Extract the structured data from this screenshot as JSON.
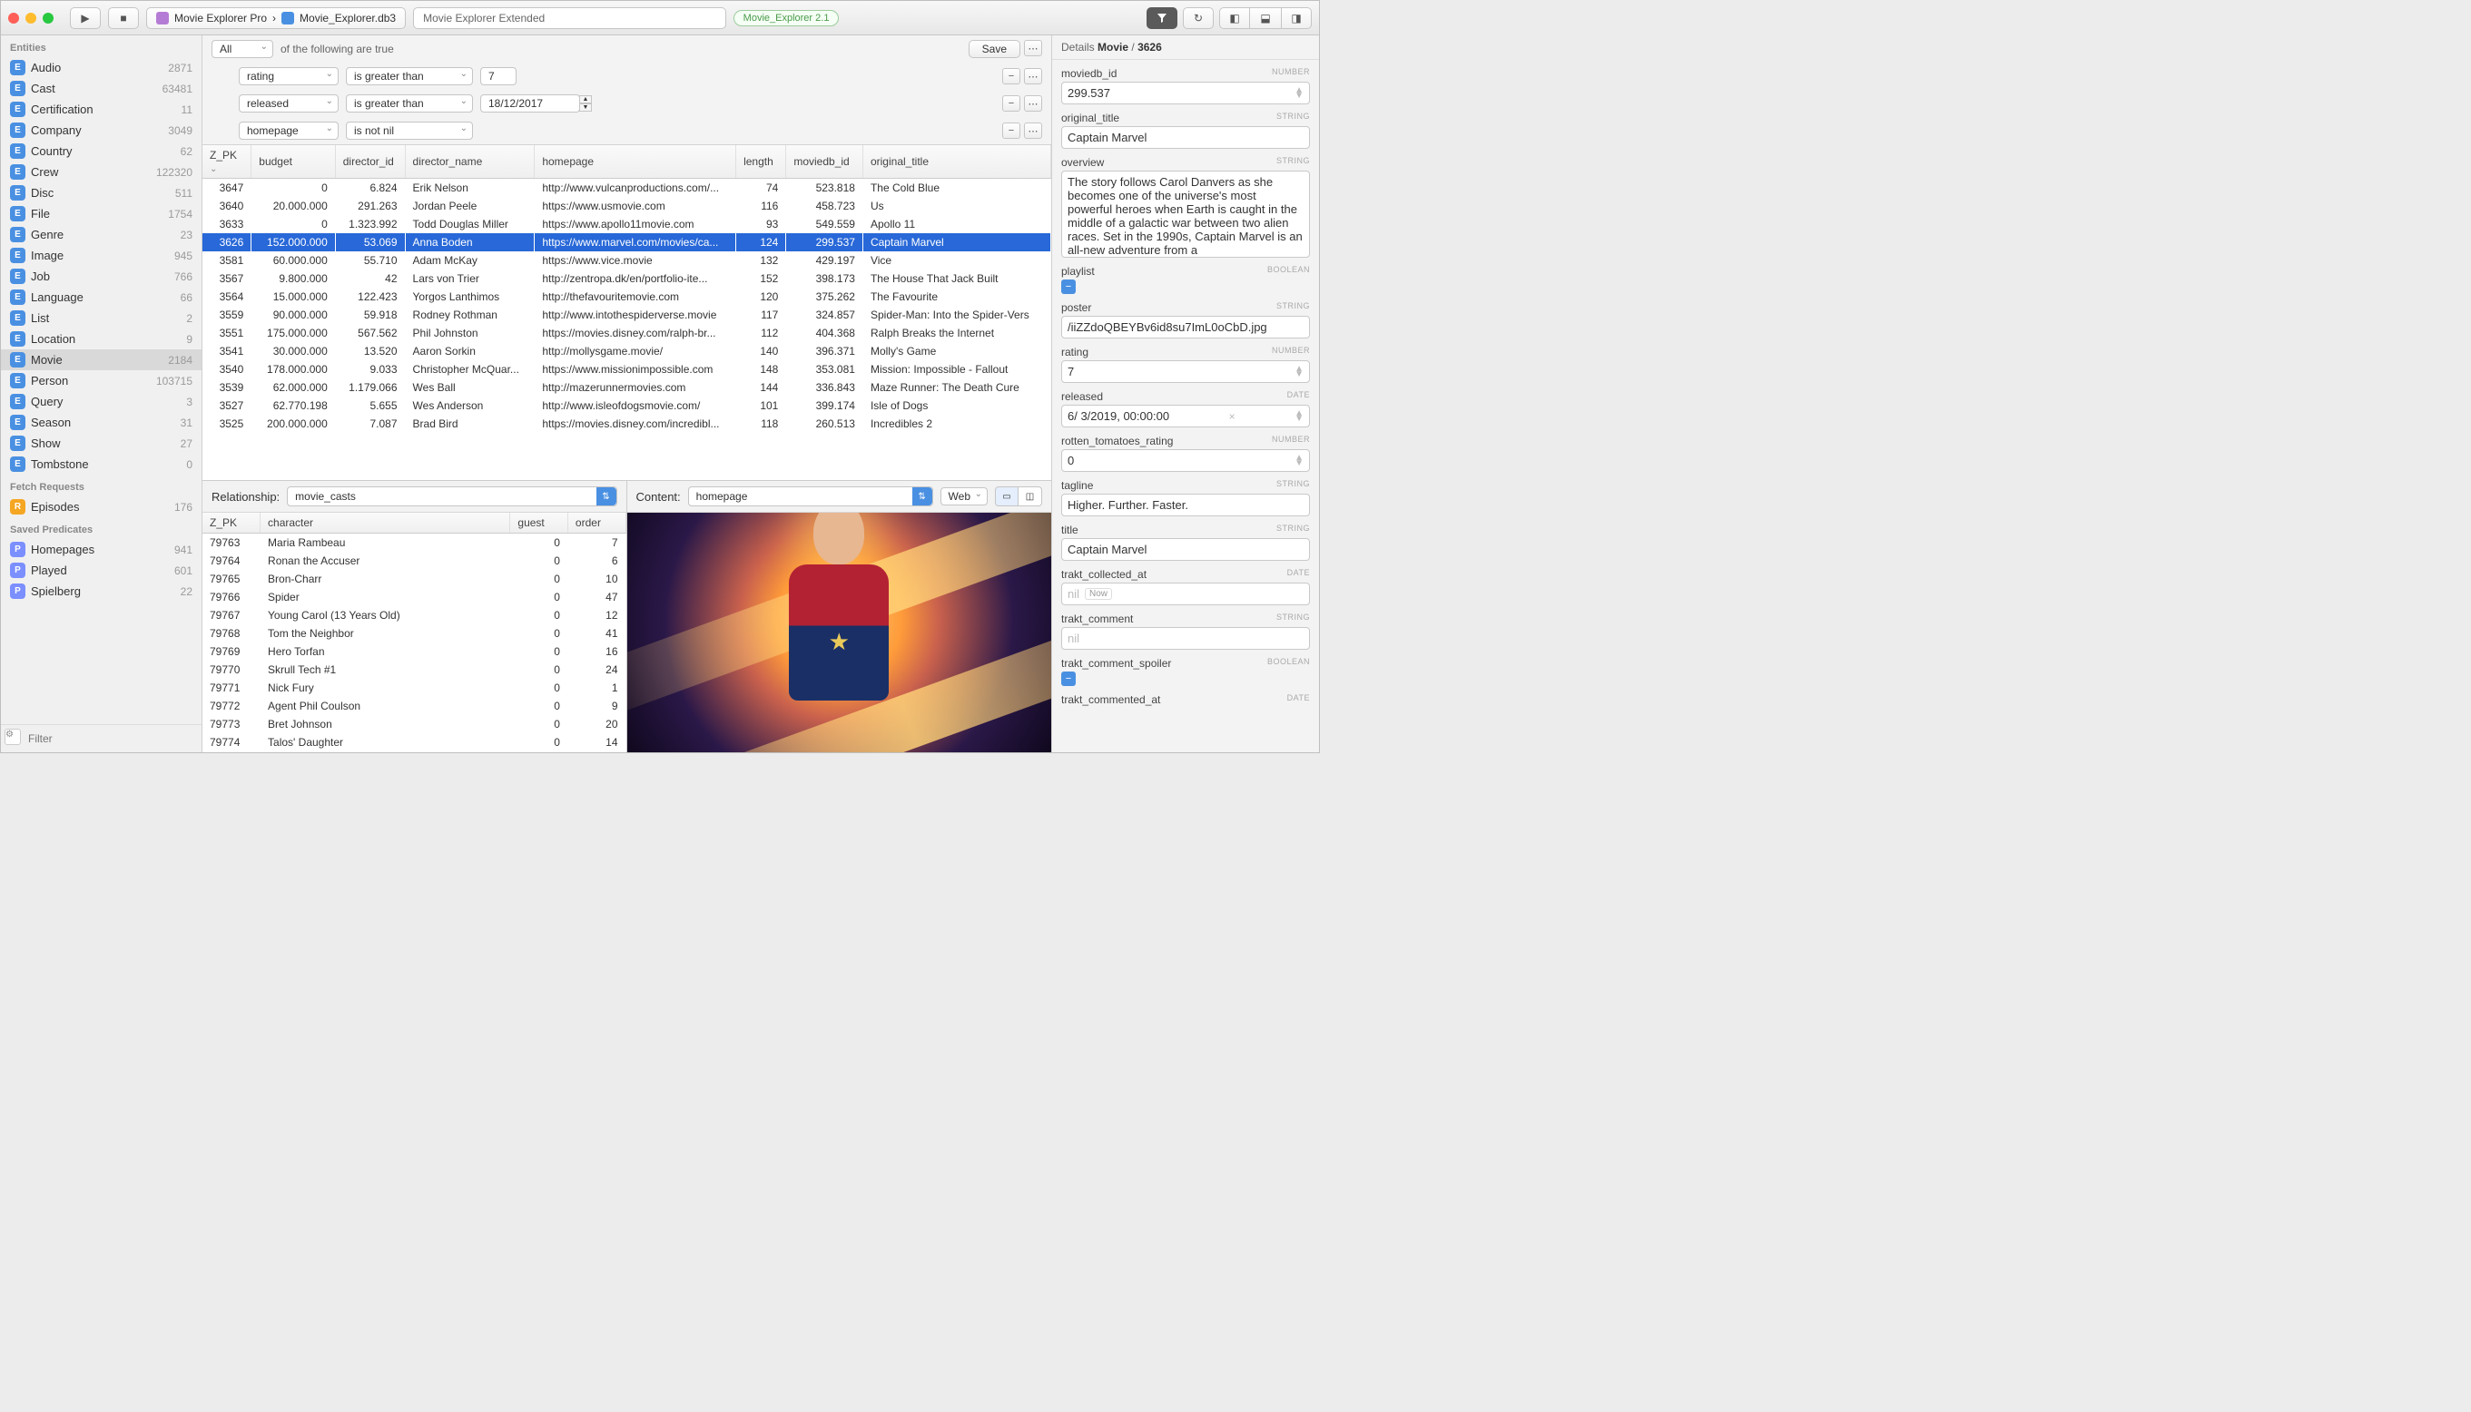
{
  "toolbar": {
    "breadcrumb": [
      "Movie Explorer Pro",
      "Movie_Explorer.db3"
    ],
    "title": "Movie Explorer Extended",
    "version": "Movie_Explorer 2.1"
  },
  "sidebar": {
    "sections": [
      {
        "title": "Entities",
        "kind": "E",
        "items": [
          {
            "label": "Audio",
            "count": "2871"
          },
          {
            "label": "Cast",
            "count": "63481"
          },
          {
            "label": "Certification",
            "count": "11"
          },
          {
            "label": "Company",
            "count": "3049"
          },
          {
            "label": "Country",
            "count": "62"
          },
          {
            "label": "Crew",
            "count": "122320"
          },
          {
            "label": "Disc",
            "count": "511"
          },
          {
            "label": "File",
            "count": "1754"
          },
          {
            "label": "Genre",
            "count": "23"
          },
          {
            "label": "Image",
            "count": "945"
          },
          {
            "label": "Job",
            "count": "766"
          },
          {
            "label": "Language",
            "count": "66"
          },
          {
            "label": "List",
            "count": "2"
          },
          {
            "label": "Location",
            "count": "9"
          },
          {
            "label": "Movie",
            "count": "2184",
            "selected": true
          },
          {
            "label": "Person",
            "count": "103715"
          },
          {
            "label": "Query",
            "count": "3"
          },
          {
            "label": "Season",
            "count": "31"
          },
          {
            "label": "Show",
            "count": "27"
          },
          {
            "label": "Tombstone",
            "count": "0"
          }
        ]
      },
      {
        "title": "Fetch Requests",
        "kind": "R",
        "items": [
          {
            "label": "Episodes",
            "count": "176"
          }
        ]
      },
      {
        "title": "Saved Predicates",
        "kind": "P",
        "items": [
          {
            "label": "Homepages",
            "count": "941"
          },
          {
            "label": "Played",
            "count": "601"
          },
          {
            "label": "Spielberg",
            "count": "22"
          }
        ]
      }
    ],
    "filter_placeholder": "Filter"
  },
  "predicates": {
    "scope": "All",
    "scope_suffix": "of the following are true",
    "save_label": "Save",
    "rows": [
      {
        "field": "rating",
        "op": "is greater than",
        "value": "7",
        "type": "number"
      },
      {
        "field": "released",
        "op": "is greater than",
        "value": "18/12/2017",
        "type": "date"
      },
      {
        "field": "homepage",
        "op": "is not nil",
        "value": null,
        "type": "nil"
      }
    ]
  },
  "main_table": {
    "columns": [
      "Z_PK",
      "budget",
      "director_id",
      "director_name",
      "homepage",
      "length",
      "moviedb_id",
      "original_title"
    ],
    "sort_col": "Z_PK",
    "rows": [
      {
        "pk": "3647",
        "budget": "0",
        "did": "6.824",
        "dname": "Erik Nelson",
        "hp": "http://www.vulcanproductions.com/...",
        "len": "74",
        "mid": "523.818",
        "title": "The Cold Blue"
      },
      {
        "pk": "3640",
        "budget": "20.000.000",
        "did": "291.263",
        "dname": "Jordan Peele",
        "hp": "https://www.usmovie.com",
        "len": "116",
        "mid": "458.723",
        "title": "Us"
      },
      {
        "pk": "3633",
        "budget": "0",
        "did": "1.323.992",
        "dname": "Todd Douglas Miller",
        "hp": "https://www.apollo11movie.com",
        "len": "93",
        "mid": "549.559",
        "title": "Apollo 11"
      },
      {
        "pk": "3626",
        "budget": "152.000.000",
        "did": "53.069",
        "dname": "Anna Boden",
        "hp": "https://www.marvel.com/movies/ca...",
        "len": "124",
        "mid": "299.537",
        "title": "Captain Marvel",
        "selected": true
      },
      {
        "pk": "3581",
        "budget": "60.000.000",
        "did": "55.710",
        "dname": "Adam McKay",
        "hp": "https://www.vice.movie",
        "len": "132",
        "mid": "429.197",
        "title": "Vice"
      },
      {
        "pk": "3567",
        "budget": "9.800.000",
        "did": "42",
        "dname": "Lars von Trier",
        "hp": "http://zentropa.dk/en/portfolio-ite...",
        "len": "152",
        "mid": "398.173",
        "title": "The House That Jack Built"
      },
      {
        "pk": "3564",
        "budget": "15.000.000",
        "did": "122.423",
        "dname": "Yorgos Lanthimos",
        "hp": "http://thefavouritemovie.com",
        "len": "120",
        "mid": "375.262",
        "title": "The Favourite"
      },
      {
        "pk": "3559",
        "budget": "90.000.000",
        "did": "59.918",
        "dname": "Rodney Rothman",
        "hp": "http://www.intothespiderverse.movie",
        "len": "117",
        "mid": "324.857",
        "title": "Spider-Man: Into the Spider-Vers"
      },
      {
        "pk": "3551",
        "budget": "175.000.000",
        "did": "567.562",
        "dname": "Phil Johnston",
        "hp": "https://movies.disney.com/ralph-br...",
        "len": "112",
        "mid": "404.368",
        "title": "Ralph Breaks the Internet"
      },
      {
        "pk": "3541",
        "budget": "30.000.000",
        "did": "13.520",
        "dname": "Aaron Sorkin",
        "hp": "http://mollysgame.movie/",
        "len": "140",
        "mid": "396.371",
        "title": "Molly's Game"
      },
      {
        "pk": "3540",
        "budget": "178.000.000",
        "did": "9.033",
        "dname": "Christopher McQuar...",
        "hp": "https://www.missionimpossible.com",
        "len": "148",
        "mid": "353.081",
        "title": "Mission: Impossible - Fallout"
      },
      {
        "pk": "3539",
        "budget": "62.000.000",
        "did": "1.179.066",
        "dname": "Wes Ball",
        "hp": "http://mazerunnermovies.com",
        "len": "144",
        "mid": "336.843",
        "title": "Maze Runner: The Death Cure"
      },
      {
        "pk": "3527",
        "budget": "62.770.198",
        "did": "5.655",
        "dname": "Wes Anderson",
        "hp": "http://www.isleofdogsmovie.com/",
        "len": "101",
        "mid": "399.174",
        "title": "Isle of Dogs"
      },
      {
        "pk": "3525",
        "budget": "200.000.000",
        "did": "7.087",
        "dname": "Brad Bird",
        "hp": "https://movies.disney.com/incredibl...",
        "len": "118",
        "mid": "260.513",
        "title": "Incredibles 2"
      }
    ]
  },
  "relationship": {
    "label": "Relationship:",
    "value": "movie_casts",
    "columns": [
      "Z_PK",
      "character",
      "guest",
      "order"
    ],
    "rows": [
      {
        "pk": "79763",
        "char": "Maria Rambeau",
        "guest": "0",
        "order": "7"
      },
      {
        "pk": "79764",
        "char": "Ronan the Accuser",
        "guest": "0",
        "order": "6"
      },
      {
        "pk": "79765",
        "char": "Bron-Charr",
        "guest": "0",
        "order": "10"
      },
      {
        "pk": "79766",
        "char": "Spider",
        "guest": "0",
        "order": "47"
      },
      {
        "pk": "79767",
        "char": "Young Carol (13 Years Old)",
        "guest": "0",
        "order": "12"
      },
      {
        "pk": "79768",
        "char": "Tom the Neighbor",
        "guest": "0",
        "order": "41"
      },
      {
        "pk": "79769",
        "char": "Hero Torfan",
        "guest": "0",
        "order": "16"
      },
      {
        "pk": "79770",
        "char": "Skrull Tech #1",
        "guest": "0",
        "order": "24"
      },
      {
        "pk": "79771",
        "char": "Nick Fury",
        "guest": "0",
        "order": "1"
      },
      {
        "pk": "79772",
        "char": "Agent Phil Coulson",
        "guest": "0",
        "order": "9"
      },
      {
        "pk": "79773",
        "char": "Bret Johnson",
        "guest": "0",
        "order": "20"
      },
      {
        "pk": "79774",
        "char": "Talos' Daughter",
        "guest": "0",
        "order": "14"
      }
    ]
  },
  "content": {
    "label": "Content:",
    "value": "homepage",
    "mode": "Web"
  },
  "details": {
    "header_prefix": "Details",
    "header_entity": "Movie",
    "header_id": "3626",
    "fields": [
      {
        "name": "moviedb_id",
        "type": "NUMBER",
        "value": "299.537",
        "kind": "number"
      },
      {
        "name": "original_title",
        "type": "STRING",
        "value": "Captain Marvel",
        "kind": "text"
      },
      {
        "name": "overview",
        "type": "STRING",
        "value": "The story follows Carol Danvers as she becomes one of the universe's most powerful heroes when Earth is caught in the middle of a galactic war between two alien races. Set in the 1990s, Captain Marvel is an all-new adventure from a",
        "kind": "textarea"
      },
      {
        "name": "playlist",
        "type": "BOOLEAN",
        "value": "-",
        "kind": "bool"
      },
      {
        "name": "poster",
        "type": "STRING",
        "value": "/iiZZdoQBEYBv6id8su7ImL0oCbD.jpg",
        "kind": "text"
      },
      {
        "name": "rating",
        "type": "NUMBER",
        "value": "7",
        "kind": "number"
      },
      {
        "name": "released",
        "type": "DATE",
        "value": "6/  3/2019, 00:00:00",
        "kind": "date"
      },
      {
        "name": "rotten_tomatoes_rating",
        "type": "NUMBER",
        "value": "0",
        "kind": "number"
      },
      {
        "name": "tagline",
        "type": "STRING",
        "value": "Higher. Further. Faster.",
        "kind": "text"
      },
      {
        "name": "title",
        "type": "STRING",
        "value": "Captain Marvel",
        "kind": "text"
      },
      {
        "name": "trakt_collected_at",
        "type": "DATE",
        "value": "nil",
        "kind": "nil-date"
      },
      {
        "name": "trakt_comment",
        "type": "STRING",
        "value": "nil",
        "kind": "nil"
      },
      {
        "name": "trakt_comment_spoiler",
        "type": "BOOLEAN",
        "value": "-",
        "kind": "bool"
      },
      {
        "name": "trakt_commented_at",
        "type": "DATE",
        "value": "",
        "kind": "label-only"
      }
    ]
  }
}
